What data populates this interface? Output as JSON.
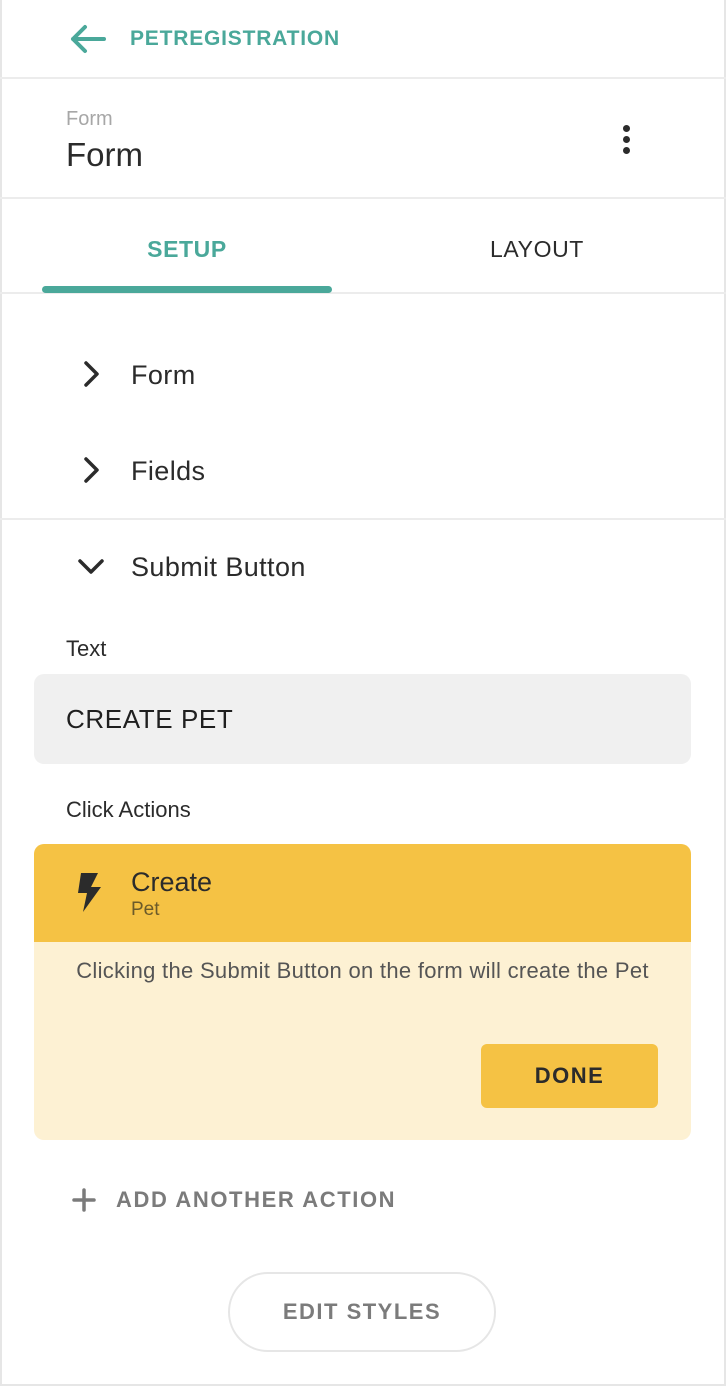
{
  "topbar": {
    "back_label": "PETREGISTRATION"
  },
  "header": {
    "crumb": "Form",
    "title": "Form"
  },
  "tabs": [
    {
      "label": "SETUP",
      "active": true
    },
    {
      "label": "LAYOUT",
      "active": false
    }
  ],
  "sections": {
    "form": "Form",
    "fields": "Fields",
    "submit_button": "Submit Button"
  },
  "submit": {
    "text_label": "Text",
    "text_value": "CREATE PET",
    "click_actions_label": "Click Actions",
    "action": {
      "title": "Create",
      "subtitle": "Pet",
      "description": "Clicking the Submit Button on the form will create the Pet",
      "done_label": "DONE"
    },
    "add_action_label": "ADD ANOTHER ACTION"
  },
  "footer": {
    "edit_styles_label": "EDIT STYLES"
  },
  "colors": {
    "accent": "#4aa89a",
    "action": "#f5c244",
    "action_body": "#fdf1d3"
  },
  "icons": {
    "back": "arrow-left-icon",
    "more": "more-vertical-icon",
    "collapsed": "chevron-right-icon",
    "expanded": "chevron-down-icon",
    "action": "lightning-icon",
    "add": "plus-icon"
  }
}
